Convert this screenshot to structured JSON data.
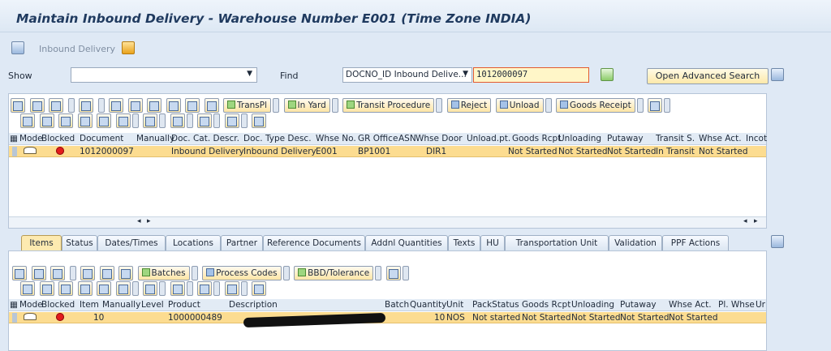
{
  "title": "Maintain Inbound Delivery - Warehouse Number E001 (Time Zone INDIA)",
  "app_toolbar": {
    "inbound_delivery_label": "Inbound Delivery"
  },
  "search": {
    "show_label": "Show",
    "show_value": "",
    "find_label": "Find",
    "find_field_value": "DOCNO_ID Inbound Delive...",
    "find_input_value": "1012000097",
    "advanced_search_label": "Open Advanced Search"
  },
  "header_toolbar": {
    "transpl": "TransPl",
    "in_yard": "In Yard",
    "transit_procedure": "Transit Procedure",
    "reject": "Reject",
    "unload": "Unload",
    "goods_receipt": "Goods Receipt"
  },
  "header_table": {
    "columns": [
      "Mode",
      "Blocked",
      "Document",
      "Manually",
      "Doc. Cat. Descr.",
      "Doc. Type Desc.",
      "Whse No.",
      "GR Office",
      "ASN",
      "Whse Door",
      "Unload.pt.",
      "Goods Rcpt",
      "Unloading",
      "Putaway",
      "Transit S.",
      "Whse Act.",
      "Incot"
    ],
    "rows": [
      {
        "document": "1012000097",
        "doc_cat": "Inbound Delivery",
        "doc_type": "Inbound Delivery",
        "whse_no": "E001",
        "gr_office": "BP1001",
        "whse_door": "DIR1",
        "goods_rcpt": "Not Started",
        "unloading": "Not Started",
        "putaway": "Not Started",
        "transit": "In Transit",
        "whse_act": "Not Started"
      }
    ]
  },
  "tabs": [
    {
      "label": "Items"
    },
    {
      "label": "Status"
    },
    {
      "label": "Dates/Times"
    },
    {
      "label": "Locations"
    },
    {
      "label": "Partner"
    },
    {
      "label": "Reference Documents"
    },
    {
      "label": "Addnl Quantities"
    },
    {
      "label": "Texts"
    },
    {
      "label": "HU"
    },
    {
      "label": "Transportation Unit"
    },
    {
      "label": "Validation"
    },
    {
      "label": "PPF Actions"
    }
  ],
  "items_toolbar": {
    "batches": "Batches",
    "process_codes": "Process Codes",
    "bbd_tolerance": "BBD/Tolerance"
  },
  "items_table": {
    "columns": [
      "Mode",
      "Blocked",
      "Item",
      "Manually",
      "Level",
      "Product",
      "Description",
      "Batch",
      "Quantity",
      "Unit",
      "PackStatus",
      "Goods Rcpt",
      "Unloading",
      "Putaway",
      "Whse Act.",
      "Pl. Whse",
      "Ur"
    ],
    "rows": [
      {
        "item": "10",
        "product": "1000000489",
        "description": "",
        "quantity": "10",
        "unit": "NOS",
        "packstatus": "Not started",
        "goods_rcpt": "Not Started",
        "unloading": "Not Started",
        "putaway": "Not Started",
        "whse_act": "Not Started"
      }
    ]
  },
  "colors": {
    "selected_row": "#fcdc90",
    "active_tab": "#fdeab0",
    "title": "#1f3a5f",
    "blocked": "#e31c1c"
  }
}
